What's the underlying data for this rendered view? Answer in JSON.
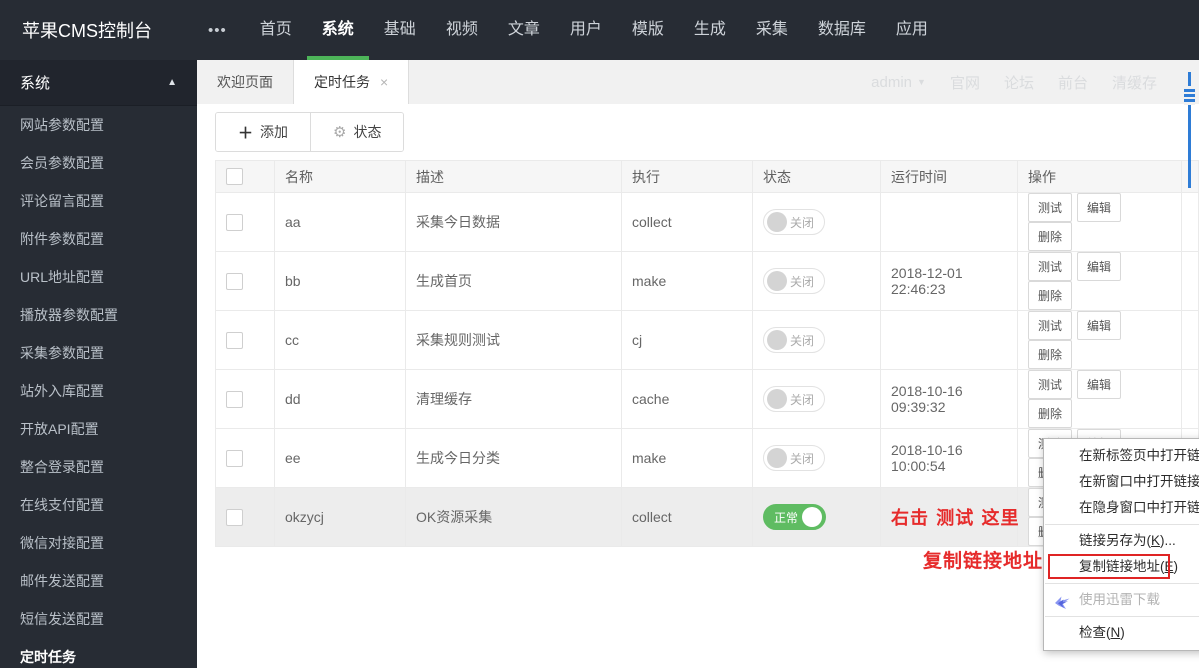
{
  "topnav": {
    "logo": "苹果CMS控制台",
    "items": [
      "首页",
      "系统",
      "基础",
      "视频",
      "文章",
      "用户",
      "模版",
      "生成",
      "采集",
      "数据库",
      "应用"
    ],
    "active": "系统"
  },
  "icons": {
    "more": "•••",
    "caret_up": "▲",
    "caret_down": "▼",
    "close": "×",
    "plus": "＋",
    "gear": "⚙"
  },
  "sidebar": {
    "section": "系统",
    "items": [
      "网站参数配置",
      "会员参数配置",
      "评论留言配置",
      "附件参数配置",
      "URL地址配置",
      "播放器参数配置",
      "采集参数配置",
      "站外入库配置",
      "开放API配置",
      "整合登录配置",
      "在线支付配置",
      "微信对接配置",
      "邮件发送配置",
      "短信发送配置",
      "定时任务"
    ],
    "active": "定时任务"
  },
  "tabs": [
    {
      "label": "欢迎页面",
      "name": "tab-welcome",
      "active": false,
      "closable": false
    },
    {
      "label": "定时任务",
      "name": "tab-timed-tasks",
      "active": true,
      "closable": true
    }
  ],
  "userbar": {
    "user": "admin",
    "links": [
      {
        "label": "官网",
        "name": "link-official-site"
      },
      {
        "label": "论坛",
        "name": "link-forum"
      },
      {
        "label": "前台",
        "name": "link-frontend"
      },
      {
        "label": "清缓存",
        "name": "link-clear-cache"
      }
    ]
  },
  "toolbar": {
    "add": "添加",
    "status": "状态"
  },
  "table": {
    "headers": [
      "名称",
      "描述",
      "执行",
      "状态",
      "运行时间",
      "操作"
    ],
    "status_on": "正常",
    "status_off": "关闭",
    "action_labels": [
      "测试",
      "编辑",
      "删除"
    ],
    "rows": [
      {
        "name": "aa",
        "desc": "采集今日数据",
        "exec": "collect",
        "status": "off",
        "time": ""
      },
      {
        "name": "bb",
        "desc": "生成首页",
        "exec": "make",
        "status": "off",
        "time": "2018-12-01 22:46:23"
      },
      {
        "name": "cc",
        "desc": "采集规则测试",
        "exec": "cj",
        "status": "off",
        "time": ""
      },
      {
        "name": "dd",
        "desc": "清理缓存",
        "exec": "cache",
        "status": "off",
        "time": "2018-10-16 09:39:32"
      },
      {
        "name": "ee",
        "desc": "生成今日分类",
        "exec": "make",
        "status": "off",
        "time": "2018-10-16 10:00:54"
      },
      {
        "name": "okzycj",
        "desc": "OK资源采集",
        "exec": "collect",
        "status": "on",
        "time": "",
        "annotation": "右击 测试 这里",
        "hover": true
      }
    ]
  },
  "annotations": {
    "row_hint": "右击 测试 这里",
    "menu_hint": "复制链接地址"
  },
  "context_menu": {
    "groups": [
      [
        {
          "pre": "在新标签页中打开链接(",
          "key": "",
          "post": "",
          "name": "menu-open-link-new-tab"
        },
        {
          "pre": "在新窗口中打开链接(",
          "key": "W",
          "post": "",
          "name": "menu-open-link-new-window"
        },
        {
          "pre": "在隐身窗口中打开链接(",
          "key": "",
          "post": "",
          "name": "menu-open-link-incognito"
        }
      ],
      [
        {
          "pre": "链接另存为(",
          "key": "K",
          "post": ")...",
          "name": "menu-save-link-as"
        },
        {
          "pre": "复制链接地址(",
          "key": "E",
          "post": ")",
          "name": "menu-copy-link-address",
          "highlight": true
        }
      ],
      [
        {
          "pre": "使用迅雷下载",
          "key": "",
          "post": "",
          "name": "menu-thunder-download",
          "disabled": true,
          "icon": "thunder-icon"
        }
      ],
      [
        {
          "pre": "检查(",
          "key": "N",
          "post": ")",
          "name": "menu-inspect"
        }
      ]
    ]
  },
  "colors": {
    "topbar_bg": "#272c34",
    "accent_green": "#4db559",
    "pill_green": "#5fbc62",
    "annotation_red": "#e62b2b",
    "scrollbar_blue": "#2e7cd6"
  }
}
